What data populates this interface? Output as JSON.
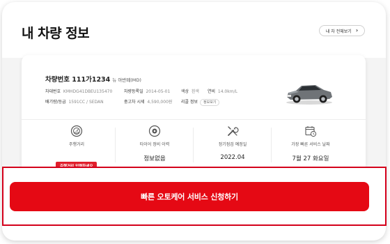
{
  "header": {
    "title": "내 차량 정보",
    "all_button_label": "내 차 전체보기"
  },
  "vehicle": {
    "plate_label": "차량번호 111가1234",
    "model": "뉴 아반떼(MD)",
    "specs_row1": [
      {
        "key": "차대번호",
        "value": "KMHDG41DBEU135470"
      },
      {
        "key": "차량등록일",
        "value": "2014-05-01"
      },
      {
        "key": "색상",
        "value": "흰색"
      },
      {
        "key": "연비",
        "value": "14.0km/L"
      }
    ],
    "specs_row2": [
      {
        "key": "배기량/등급",
        "value": "1591CC / SEDAN"
      },
      {
        "key": "중고차 시세",
        "value": "4,590,000원"
      },
      {
        "key": "리콜 정보",
        "value": ""
      }
    ],
    "recall_chip": "정보보기"
  },
  "stats": [
    {
      "icon": "odometer-icon",
      "label": "주행거리",
      "value": ""
    },
    {
      "icon": "tire-icon",
      "label": "타이어 정비 이력",
      "value": "정보없음"
    },
    {
      "icon": "wrench-icon",
      "label": "정기점검 예정일",
      "value": "2022.04"
    },
    {
      "icon": "calendar-clock-icon",
      "label": "가장 빠른 서비스 날짜",
      "value": "7월 27 화요일"
    }
  ],
  "mileage_badge": "주행거리 입력하세요",
  "cta_label": "빠른 오토케어 서비스 신청하기",
  "colors": {
    "accent": "#e50914",
    "highlight_border": "#d4001b",
    "badge": "#e01e2b"
  }
}
